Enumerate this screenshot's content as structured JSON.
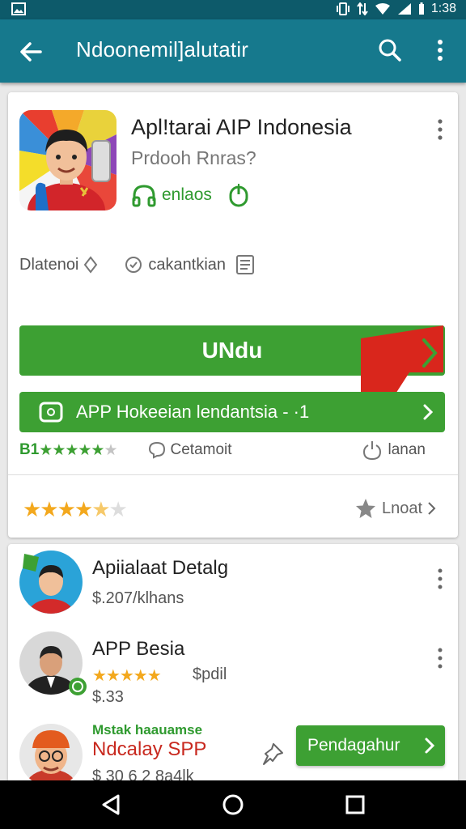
{
  "status_bar": {
    "time": "1:38"
  },
  "app_bar": {
    "title": "Ndoonemil]alutatir"
  },
  "app": {
    "title": "Apl!tarai AIP Indonesia",
    "developer": "Prdooh Rnras?",
    "badge_label": "enlaos",
    "info_left": "Dlatenoi",
    "info_right": "cakantkian",
    "install_label": "UNdu",
    "promo_label": "APP Hokeeian lendantsia - ·1",
    "stats_count": "B1",
    "stats_comments": "Cetamoit",
    "stats_right": "lanan",
    "rating_link": "Lnoat",
    "rating_stars": 4.5
  },
  "list": [
    {
      "name": "Apiialaat Detalg",
      "meta": "$.207/klhans"
    },
    {
      "name": "APP Besia",
      "rating_text": "$pdil",
      "meta": "$.33"
    },
    {
      "tag": "Mstak haauamse",
      "name": "Ndcalay SPP",
      "meta": "$ 30 6 2 8a4lk",
      "cta": "Pendagahur"
    }
  ],
  "colors": {
    "teal": "#16798d",
    "green": "#3da033",
    "red": "#d9261c",
    "star": "#f3a81d"
  }
}
